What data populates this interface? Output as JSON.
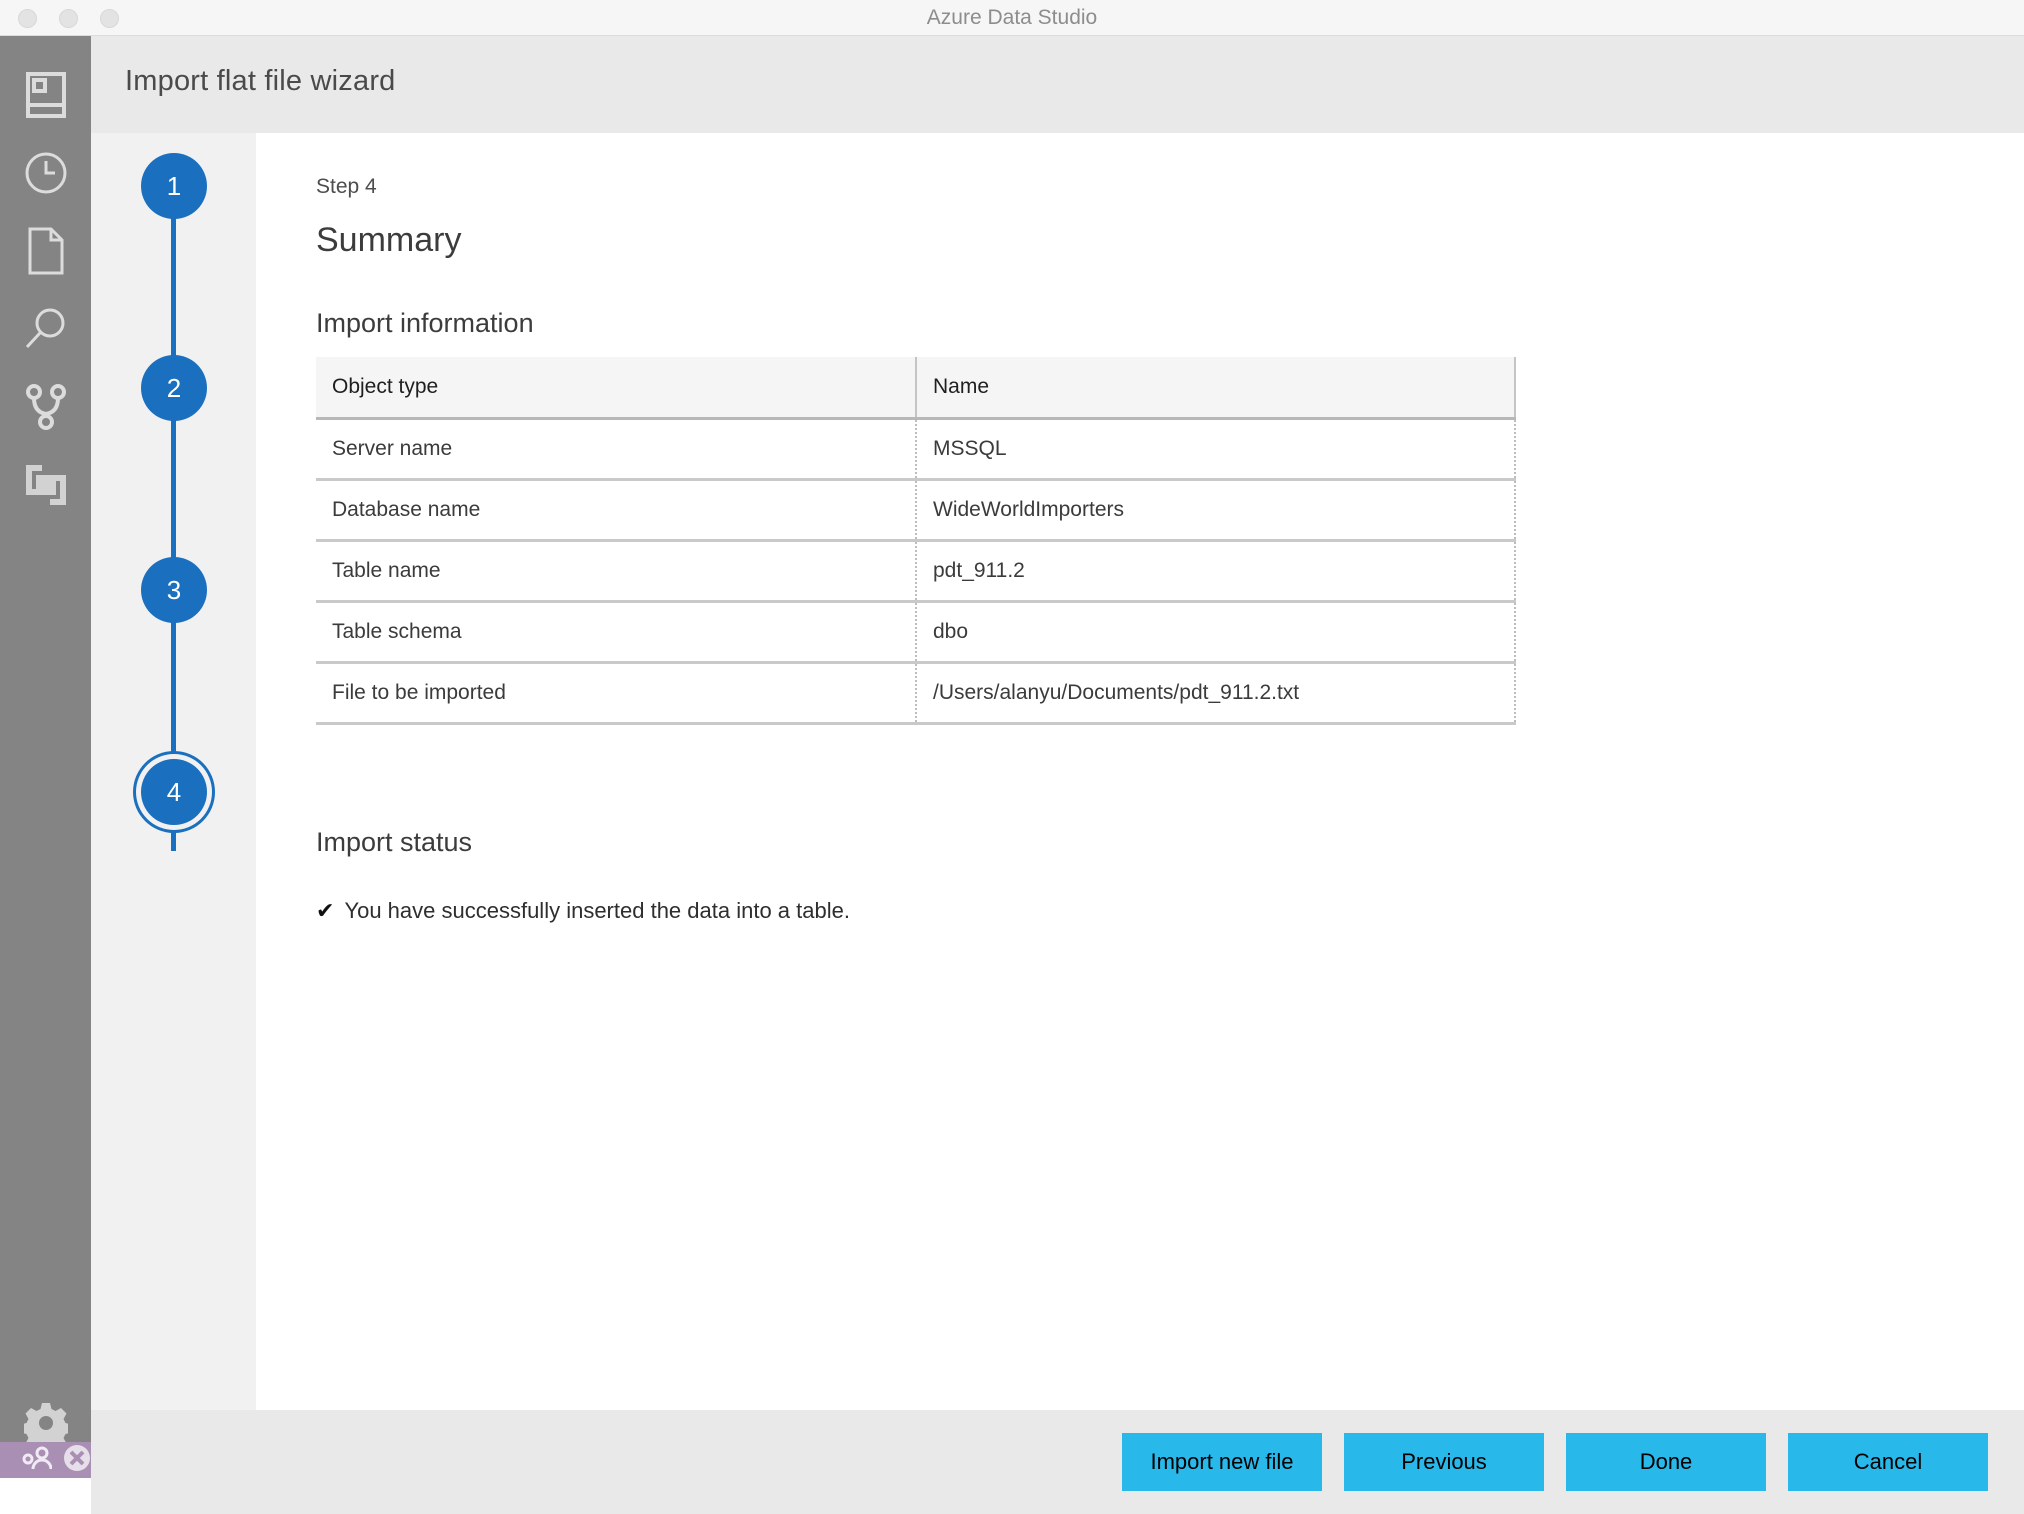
{
  "window": {
    "title": "Azure Data Studio",
    "traffic_lights": [
      "close",
      "minimize",
      "maximize"
    ]
  },
  "activity_bar": {
    "items": [
      {
        "icon": "servers-icon",
        "label": "Servers"
      },
      {
        "icon": "history-clock-icon",
        "label": "History"
      },
      {
        "icon": "notebook-file-icon",
        "label": "Notebooks"
      },
      {
        "icon": "search-icon",
        "label": "Search"
      },
      {
        "icon": "source-control-branch-icon",
        "label": "Source Control"
      },
      {
        "icon": "extensions-icon",
        "label": "Extensions"
      }
    ],
    "bottom_items": [
      {
        "icon": "gear-icon",
        "label": "Manage"
      }
    ],
    "status_bar": {
      "background": "#a98fb4",
      "items": [
        {
          "icon": "account-icon",
          "label": "Accounts"
        },
        {
          "icon": "error-circle-icon",
          "label": "Errors"
        }
      ]
    }
  },
  "wizard": {
    "header_title": "Import flat file wizard",
    "steps": [
      {
        "number": "1",
        "current": false
      },
      {
        "number": "2",
        "current": false
      },
      {
        "number": "3",
        "current": false
      },
      {
        "number": "4",
        "current": true
      }
    ],
    "step_label": "Step 4",
    "page_heading": "Summary",
    "import_information": {
      "heading": "Import information",
      "columns": [
        "Object type",
        "Name"
      ],
      "rows": [
        {
          "type": "Server name",
          "name": "MSSQL"
        },
        {
          "type": "Database name",
          "name": "WideWorldImporters"
        },
        {
          "type": "Table name",
          "name": "pdt_911.2"
        },
        {
          "type": "Table schema",
          "name": "dbo"
        },
        {
          "type": "File to be imported",
          "name": "/Users/alanyu/Documents/pdt_911.2.txt"
        }
      ]
    },
    "import_status": {
      "heading": "Import status",
      "check_glyph": "✔",
      "message": "You have successfully inserted the data into a table."
    },
    "footer_buttons": [
      {
        "label": "Import new file"
      },
      {
        "label": "Previous"
      },
      {
        "label": "Done"
      },
      {
        "label": "Cancel"
      }
    ]
  },
  "colors": {
    "accent_step": "#1a6fbf",
    "button": "#29b8ea",
    "activity_bar": "#848484",
    "status_bar": "#a98fb4",
    "header": "#e9e9e9"
  }
}
